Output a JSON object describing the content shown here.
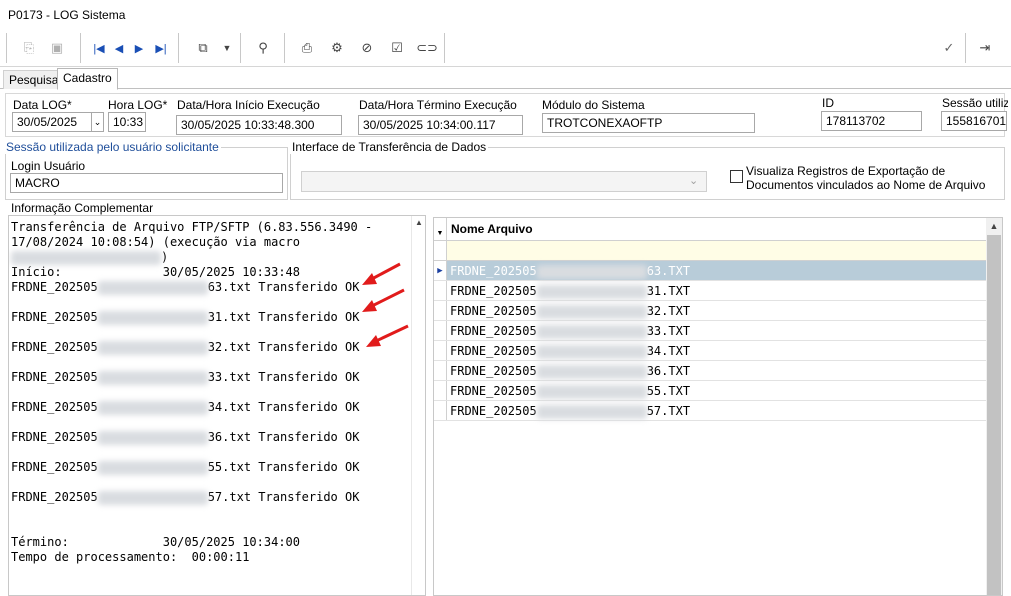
{
  "window": {
    "title": "P0173 - LOG Sistema"
  },
  "toolbar": {
    "icons": [
      "copy-icon",
      "save-icon",
      "first-record-icon",
      "prev-record-icon",
      "next-record-icon",
      "last-record-icon",
      "export-icon",
      "dropdown-icon",
      "binoculars-icon",
      "print-icon",
      "gear-icon",
      "attach-icon",
      "check-box-icon",
      "link-icon",
      "confirm-icon",
      "exit-icon"
    ]
  },
  "tabs": [
    {
      "label": "Pesquisa"
    },
    {
      "label": "Cadastro"
    }
  ],
  "form": {
    "data_log": {
      "label": "Data LOG*",
      "value": "30/05/2025"
    },
    "hora_log": {
      "label": "Hora LOG*",
      "value": "10:33"
    },
    "inicio_exec": {
      "label": "Data/Hora Início Execução",
      "value": "30/05/2025 10:33:48.300"
    },
    "termino_exec": {
      "label": "Data/Hora Término Execução",
      "value": "30/05/2025 10:34:00.117"
    },
    "modulo": {
      "label": "Módulo do Sistema",
      "value": "TROTCONEXAOFTP"
    },
    "id": {
      "label": "ID",
      "value": "178113702"
    },
    "sessao": {
      "label": "Sessão utiliza",
      "value": "155816701"
    }
  },
  "sessao_group": {
    "title": "Sessão utilizada pelo usuário solicitante",
    "login_label": "Login Usuário",
    "login_value": "MACRO"
  },
  "interface_group": {
    "title": "Interface de Transferência de Dados",
    "select_value": "",
    "checkbox_label_1": "Visualiza Registros de Exportação de",
    "checkbox_label_2": "Documentos vinculados ao Nome de Arquivo",
    "checked": false
  },
  "info": {
    "title": "Informação Complementar",
    "header_1": "Transferência de Arquivo FTP/SFTP (6.83.556.3490 -",
    "header_2": "17/08/2024 10:08:54) (execução via macro",
    "header_3": ")",
    "inicio_label": "Início:",
    "inicio_value": "30/05/2025 10:33:48",
    "file_prefix": "FRDNE_202505",
    "status": "Transferido OK",
    "files": [
      "63.txt",
      "31.txt",
      "32.txt",
      "33.txt",
      "34.txt",
      "36.txt",
      "55.txt",
      "57.txt"
    ],
    "termino_label": "Término:",
    "termino_value": "30/05/2025 10:34:00",
    "tempo_label": "Tempo de processamento:",
    "tempo_value": "00:00:11"
  },
  "grid": {
    "column": "Nome Arquivo",
    "prefix": "FRDNE_202505",
    "rows": [
      "63.TXT",
      "31.TXT",
      "32.TXT",
      "33.TXT",
      "34.TXT",
      "36.TXT",
      "55.TXT",
      "57.TXT"
    ],
    "selected_index": 0
  },
  "colors": {
    "annotation_arrow": "#e11b1b",
    "selected_row": "#b8ccd9",
    "group_title": "#1f4e9a"
  }
}
